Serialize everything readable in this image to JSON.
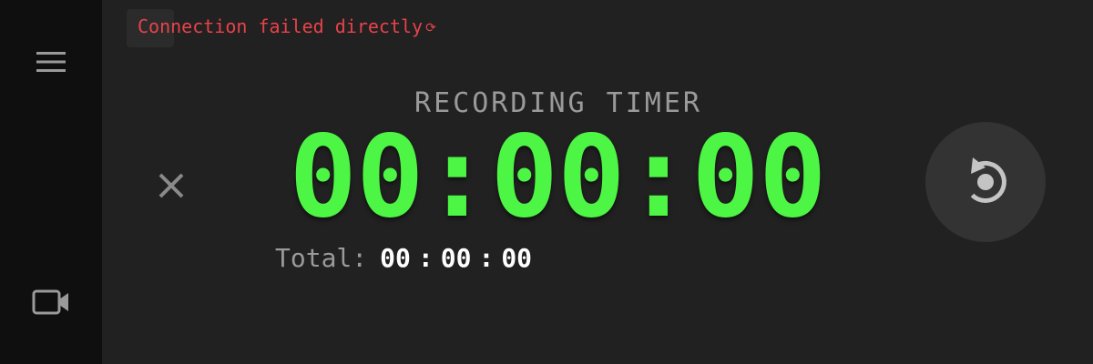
{
  "sidebar": {
    "menu_icon": "hamburger-menu-icon",
    "camera_icon": "video-camera-icon"
  },
  "status": {
    "message": "Connection failed directly",
    "retry_glyph": "⟳",
    "color": "#e8424b"
  },
  "timer": {
    "title": "RECORDING TIMER",
    "display": "00:00:00",
    "color": "#4df544"
  },
  "total": {
    "label": "Total:",
    "hours": "00",
    "minutes": "00",
    "seconds": "00",
    "separator": ":"
  },
  "controls": {
    "close_icon": "close-icon",
    "reset_icon": "reset-icon"
  }
}
